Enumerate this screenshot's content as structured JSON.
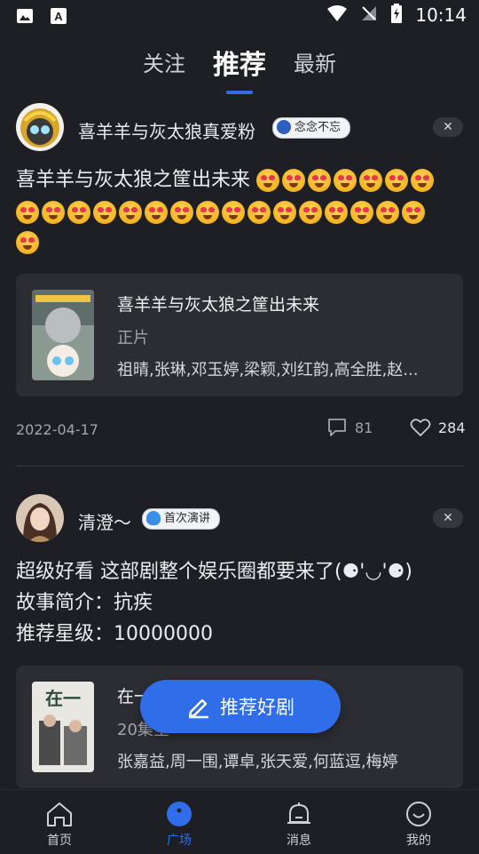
{
  "status_bar": {
    "time": "10:14"
  },
  "tabs": [
    {
      "label": "关注"
    },
    {
      "label": "推荐"
    },
    {
      "label": "最新"
    }
  ],
  "posts": [
    {
      "username": "喜羊羊与灰太狼真爱粉",
      "badge": "念念不忘",
      "text": "喜羊羊与灰太狼之筐出未来",
      "card": {
        "title": "喜羊羊与灰太狼之筐出未来",
        "subtitle": "正片",
        "cast": "祖晴,张琳,邓玉婷,梁颖,刘红韵,高全胜,赵..."
      },
      "date": "2022-04-17",
      "comments": "81",
      "likes": "284"
    },
    {
      "username": "清澄〜",
      "badge": "首次演讲",
      "lines": [
        "超级好看  这部剧整个娱乐圈都要来了(⚈'◡'⚈)",
        "故事简介：抗疾",
        "推荐星级：10000000"
      ],
      "card": {
        "title": "在一",
        "subtitle": "20集全",
        "cast": "张嘉益,周一围,谭卓,张天爱,何蓝逗,梅婷"
      }
    }
  ],
  "fab": {
    "label": "推荐好剧"
  },
  "bottom_nav": [
    {
      "label": "首页",
      "icon": "home-icon"
    },
    {
      "label": "广场",
      "icon": "square-icon"
    },
    {
      "label": "消息",
      "icon": "bell-icon"
    },
    {
      "label": "我的",
      "icon": "smile-icon"
    }
  ],
  "colors": {
    "accent": "#2f6ee8",
    "background": "#1e1f24",
    "card": "#2b2d33"
  }
}
